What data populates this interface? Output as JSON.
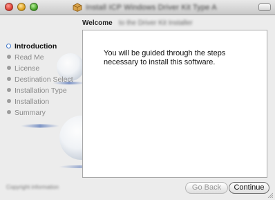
{
  "window": {
    "title_text": "Install ICP Windows Driver Kit Type A",
    "controls": {
      "close": "close",
      "minimize": "minimize",
      "zoom": "zoom"
    }
  },
  "pane": {
    "label": "Welcome",
    "subtitle": "to the Driver Kit Installer"
  },
  "steps": [
    {
      "label": "Introduction",
      "active": true
    },
    {
      "label": "Read Me",
      "active": false
    },
    {
      "label": "License",
      "active": false
    },
    {
      "label": "Destination Select",
      "active": false
    },
    {
      "label": "Installation Type",
      "active": false
    },
    {
      "label": "Installation",
      "active": false
    },
    {
      "label": "Summary",
      "active": false
    }
  ],
  "content": {
    "body": "You will be guided through the steps necessary to install this software."
  },
  "footer": {
    "left_text": "Copyright information"
  },
  "buttons": {
    "back": "Go Back",
    "continue": "Continue"
  },
  "colors": {
    "active_step_bullet": "#3b74c8",
    "close": "#d9362a",
    "minimize": "#d99a14",
    "zoom": "#3c9a1e"
  }
}
